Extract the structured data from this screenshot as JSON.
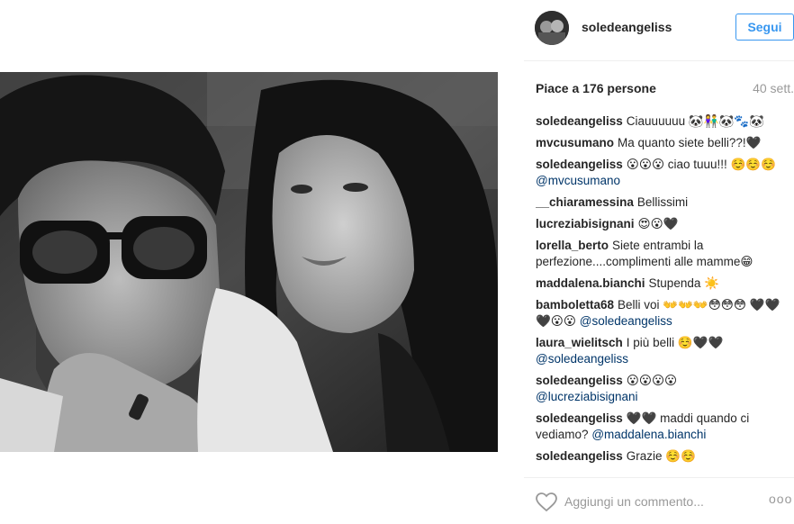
{
  "post": {
    "username": "soledeangeliss",
    "follow_label": "Segui",
    "likes_text": "Piace a 176 persone",
    "time_ago": "40 sett."
  },
  "comments": [
    {
      "user": "soledeangeliss",
      "text": "Ciauuuuuu 🐼👫🐼🐾🐼",
      "mention": ""
    },
    {
      "user": "mvcusumano",
      "text": "Ma quanto siete belli??!🖤",
      "mention": ""
    },
    {
      "user": "soledeangeliss",
      "text": "😮😮😮 ciao tuuu!!! ☺️☺️☺️",
      "mention": "@mvcusumano"
    },
    {
      "user": "__chiaramessina",
      "text": "Bellissimi",
      "mention": ""
    },
    {
      "user": "lucreziabisignani",
      "text": "😍😮🖤",
      "mention": ""
    },
    {
      "user": "lorella_berto",
      "text": "Siete entrambi la perfezione....complimenti alle mamme😁",
      "mention": ""
    },
    {
      "user": "maddalena.bianchi",
      "text": "Stupenda ☀️",
      "mention": ""
    },
    {
      "user": "bamboletta68",
      "text": "Belli voi 👐👐👐😳😳😳 🖤🖤🖤😮😮",
      "mention": "@soledeangeliss"
    },
    {
      "user": "laura_wielitsch",
      "text": "I più belli ☺️🖤🖤",
      "mention": "@soledeangeliss"
    },
    {
      "user": "soledeangeliss",
      "text": "😮😮😮😮",
      "mention": "@lucreziabisignani"
    },
    {
      "user": "soledeangeliss",
      "text": "🖤🖤 maddi quando ci vediamo?",
      "mention": "@maddalena.bianchi"
    },
    {
      "user": "soledeangeliss",
      "text": "Grazie ☺️☺️",
      "mention": ""
    }
  ],
  "footer": {
    "comment_placeholder": "Aggiungi un commento...",
    "more_label": "ooo"
  },
  "icons": {
    "heart": "heart-icon",
    "more": "more-options-icon"
  },
  "colors": {
    "accent": "#3897f0",
    "mention": "#003569",
    "muted": "#999999"
  }
}
